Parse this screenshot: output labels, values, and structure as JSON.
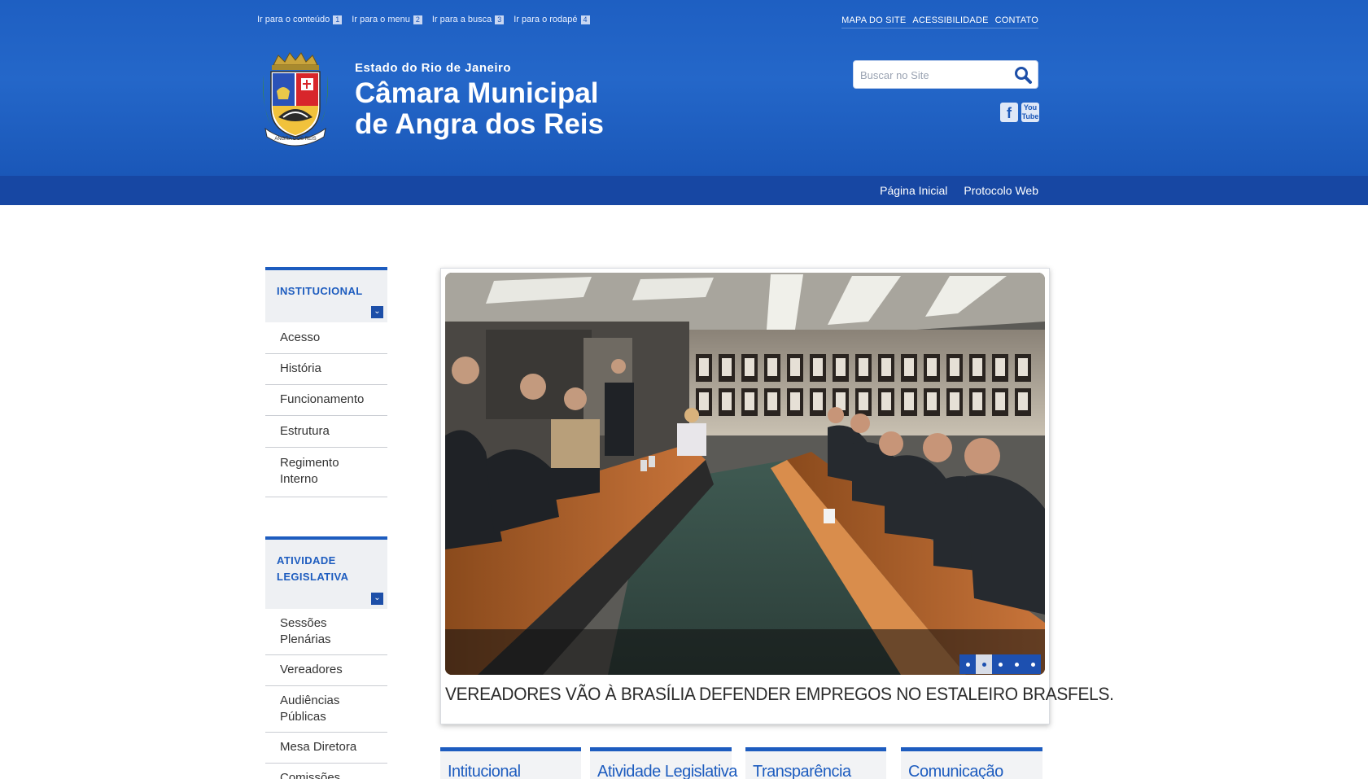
{
  "skip_links": [
    {
      "label": "Ir para o conteúdo",
      "key": "1"
    },
    {
      "label": "Ir para o menu",
      "key": "2"
    },
    {
      "label": "Ir para a busca",
      "key": "3"
    },
    {
      "label": "Ir para o rodapé",
      "key": "4"
    }
  ],
  "top_links": [
    "MAPA DO SITE",
    "ACESSIBILIDADE",
    "CONTATO"
  ],
  "header": {
    "state": "Estado do Rio de Janeiro",
    "title_line1": "Câmara Municipal",
    "title_line2": "de Angra dos Reis"
  },
  "search": {
    "placeholder": "Buscar no Site",
    "value": ""
  },
  "social": {
    "facebook": "f",
    "youtube_top": "You",
    "youtube_bottom": "Tube"
  },
  "nav": [
    "Página Inicial",
    "Protocolo Web"
  ],
  "sidebar": [
    {
      "heading": "INSTITUCIONAL",
      "items": [
        "Acesso",
        "História",
        "Funcionamento",
        "Estrutura",
        "Regimento Interno"
      ]
    },
    {
      "heading": "ATIVIDADE LEGISLATIVA",
      "items": [
        "Sessões Plenárias",
        "Vereadores",
        "Audiências Públicas",
        "Mesa Diretora",
        "Comissões"
      ]
    }
  ],
  "slider": {
    "caption": "VEREADORES VÃO À BRASÍLIA DEFENDER EMPREGOS NO ESTALEIRO BRASFELS.",
    "slide_count": 5,
    "active_index": 1
  },
  "bottom_tabs": [
    "Intitucional",
    "Atividade Legislativa",
    "Transparência",
    "Comunicação"
  ],
  "colors": {
    "brand_blue": "#1d5cbf",
    "header_blue": "#2467c9",
    "navbar_blue": "#1747a3"
  }
}
